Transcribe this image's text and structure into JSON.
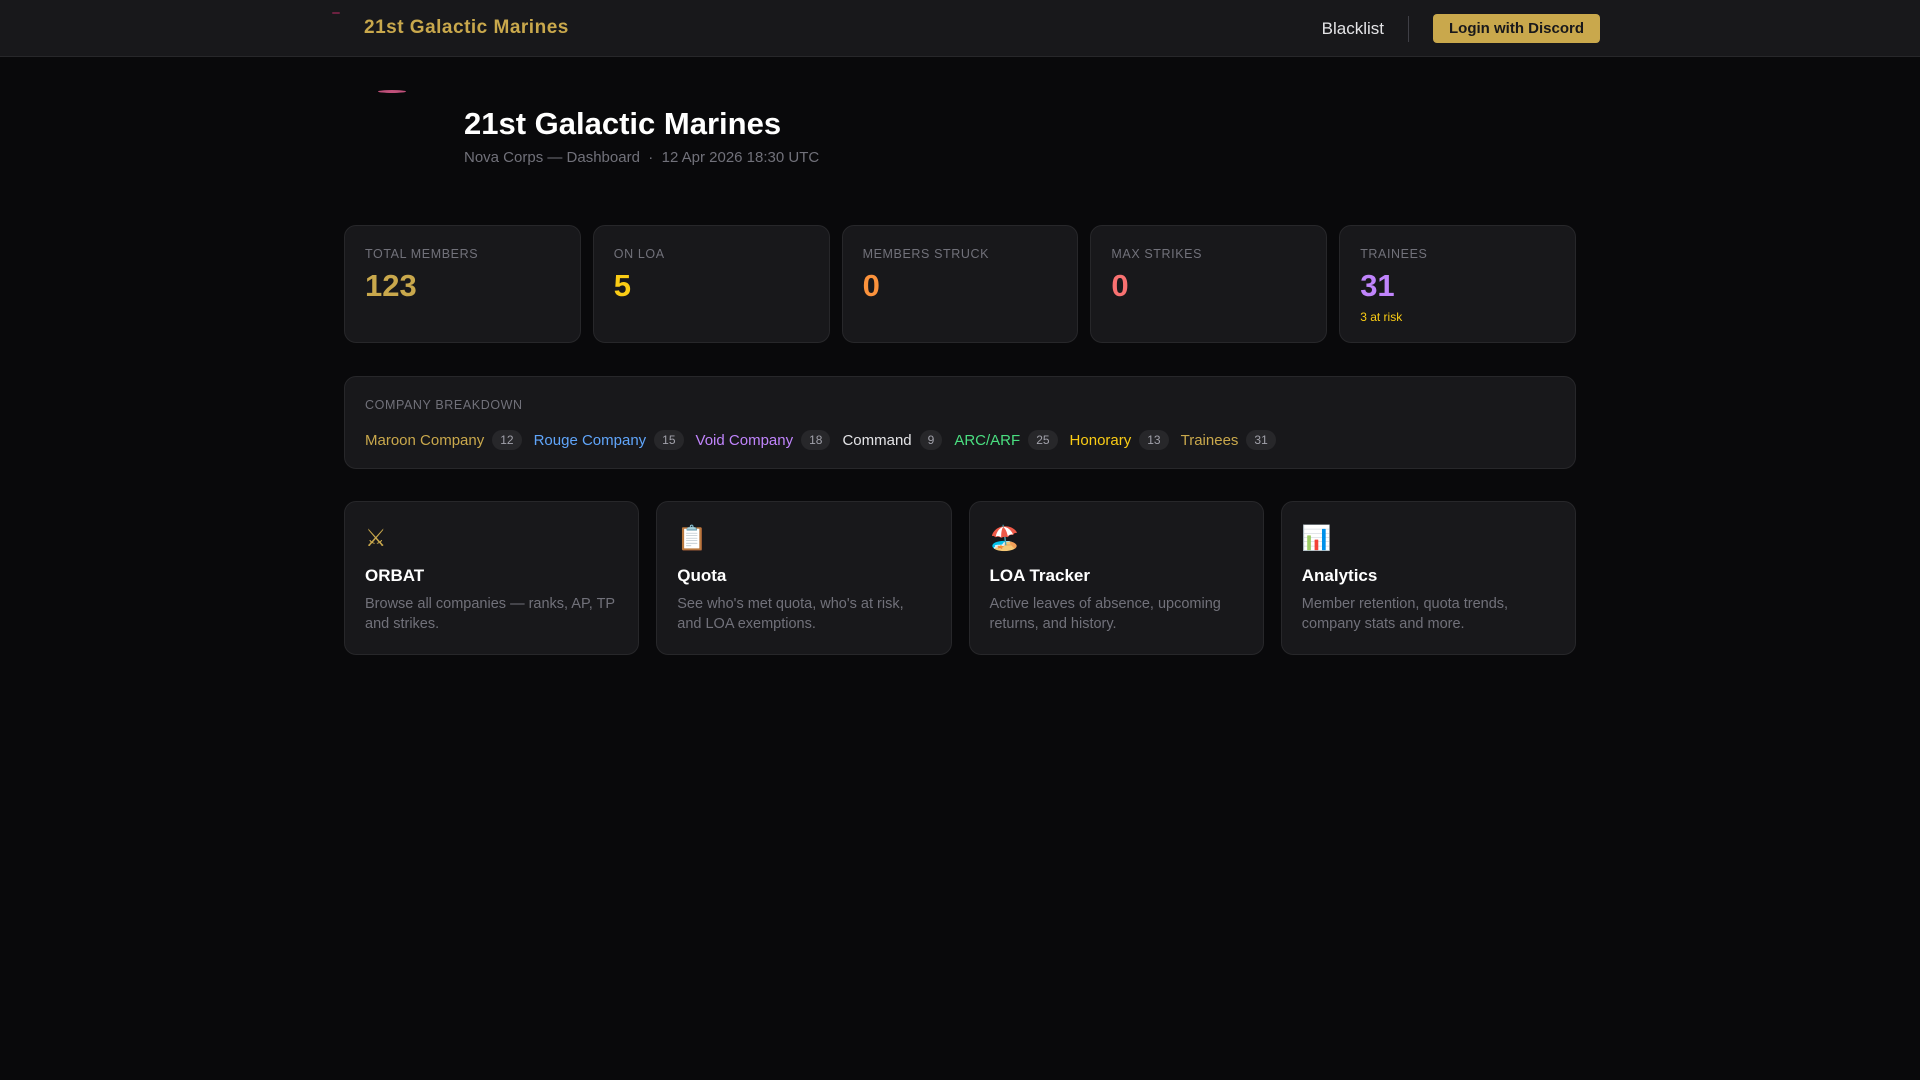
{
  "header": {
    "brand": "21st Galactic Marines",
    "blacklist": "Blacklist",
    "login": "Login with Discord"
  },
  "page": {
    "title": "21st Galactic Marines",
    "subtitle": "Nova Corps — Dashboard",
    "sep": "·",
    "timestamp": "12 Apr 2026 18:30 UTC"
  },
  "stats": [
    {
      "label": "TOTAL MEMBERS",
      "value": "123",
      "color": "#c9a84c"
    },
    {
      "label": "ON LOA",
      "value": "5",
      "color": "#facc15"
    },
    {
      "label": "MEMBERS STRUCK",
      "value": "0",
      "color": "#fb923c"
    },
    {
      "label": "MAX STRIKES",
      "value": "0",
      "color": "#f87171"
    },
    {
      "label": "TRAINEES",
      "value": "31",
      "color": "#c084fc",
      "note": "3 at risk"
    }
  ],
  "breakdown": {
    "title": "COMPANY BREAKDOWN",
    "items": [
      {
        "name": "Maroon Company",
        "count": "12",
        "color": "#c9a84c"
      },
      {
        "name": "Rouge Company",
        "count": "15",
        "color": "#60a5fa"
      },
      {
        "name": "Void Company",
        "count": "18",
        "color": "#c084fc"
      },
      {
        "name": "Command",
        "count": "9",
        "color": "#e4e4e7"
      },
      {
        "name": "ARC/ARF",
        "count": "25",
        "color": "#4ade80"
      },
      {
        "name": "Honorary",
        "count": "13",
        "color": "#facc15"
      },
      {
        "name": "Trainees",
        "count": "31",
        "color": "#c9a84c"
      }
    ]
  },
  "features": [
    {
      "icon": "⚔",
      "title": "ORBAT",
      "desc": "Browse all companies — ranks, AP, TP and strikes."
    },
    {
      "icon": "📋",
      "title": "Quota",
      "desc": "See who's met quota, who's at risk, and LOA exemptions."
    },
    {
      "icon": "🏖️",
      "title": "LOA Tracker",
      "desc": "Active leaves of absence, upcoming returns, and history."
    },
    {
      "icon": "📊",
      "title": "Analytics",
      "desc": "Member retention, quota trends, company stats and more."
    }
  ]
}
